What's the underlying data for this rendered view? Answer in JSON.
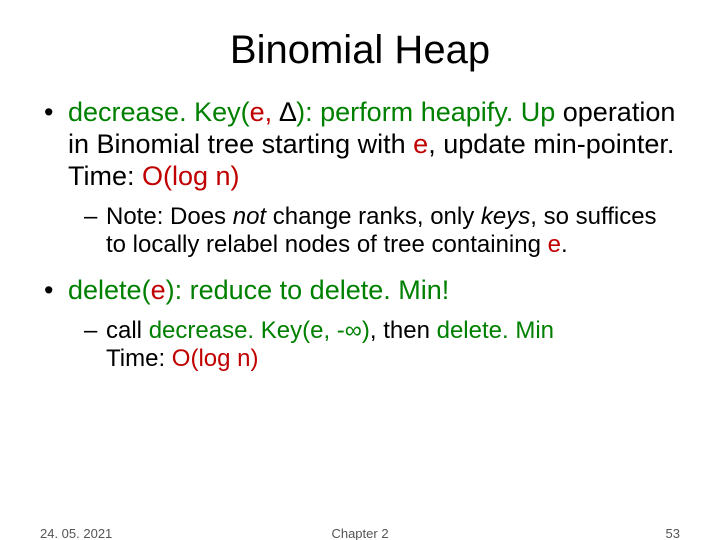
{
  "title": "Binomial Heap",
  "bullet1": {
    "fn": "decrease. Key(",
    "arg_e": "e, ",
    "delta": "∆",
    "close": "): perform ",
    "heapify": "heapify. Up",
    "rest1": " operation in Binomial tree starting with ",
    "e2": "e",
    "rest2": ", update min-pointer. Time: ",
    "time": "O(log n)",
    "note_prefix": "Note: Does ",
    "note_not": "not",
    "note_mid": " change ranks, only ",
    "note_keys": "keys",
    "note_rest": ", so suffices to locally relabel nodes of tree containing ",
    "note_e": "e",
    "note_end": "."
  },
  "bullet2": {
    "fn": "delete(",
    "arg_e": "e",
    "close": "): reduce to ",
    "delmin": "delete. Min!",
    "sub_prefix": "call ",
    "sub_call": "decrease. Key(e, -",
    "sub_inf": "∞",
    "sub_call2": ")",
    "sub_mid": ", then ",
    "sub_delmin": "delete. Min",
    "sub_time_lbl": "Time: ",
    "sub_time": "O(log n)"
  },
  "footer": {
    "date": "24. 05. 2021",
    "chapter": "Chapter 2",
    "page": "53"
  }
}
